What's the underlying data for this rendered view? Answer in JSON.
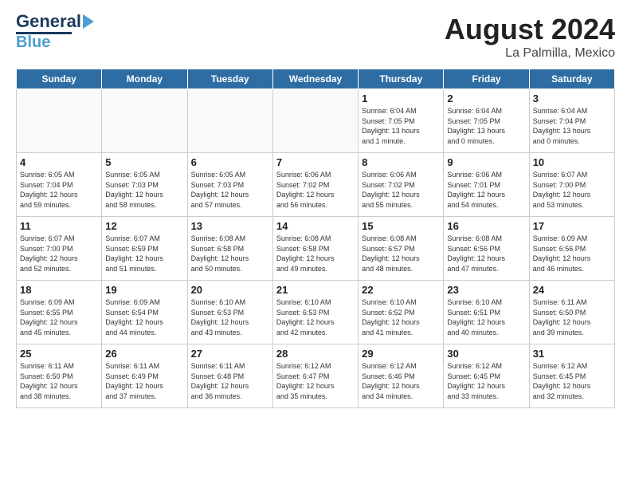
{
  "header": {
    "logo_top": "General",
    "logo_bottom": "Blue",
    "month": "August 2024",
    "location": "La Palmilla, Mexico"
  },
  "weekdays": [
    "Sunday",
    "Monday",
    "Tuesday",
    "Wednesday",
    "Thursday",
    "Friday",
    "Saturday"
  ],
  "weeks": [
    [
      {
        "day": "",
        "info": ""
      },
      {
        "day": "",
        "info": ""
      },
      {
        "day": "",
        "info": ""
      },
      {
        "day": "",
        "info": ""
      },
      {
        "day": "1",
        "info": "Sunrise: 6:04 AM\nSunset: 7:05 PM\nDaylight: 13 hours\nand 1 minute."
      },
      {
        "day": "2",
        "info": "Sunrise: 6:04 AM\nSunset: 7:05 PM\nDaylight: 13 hours\nand 0 minutes."
      },
      {
        "day": "3",
        "info": "Sunrise: 6:04 AM\nSunset: 7:04 PM\nDaylight: 13 hours\nand 0 minutes."
      }
    ],
    [
      {
        "day": "4",
        "info": "Sunrise: 6:05 AM\nSunset: 7:04 PM\nDaylight: 12 hours\nand 59 minutes."
      },
      {
        "day": "5",
        "info": "Sunrise: 6:05 AM\nSunset: 7:03 PM\nDaylight: 12 hours\nand 58 minutes."
      },
      {
        "day": "6",
        "info": "Sunrise: 6:05 AM\nSunset: 7:03 PM\nDaylight: 12 hours\nand 57 minutes."
      },
      {
        "day": "7",
        "info": "Sunrise: 6:06 AM\nSunset: 7:02 PM\nDaylight: 12 hours\nand 56 minutes."
      },
      {
        "day": "8",
        "info": "Sunrise: 6:06 AM\nSunset: 7:02 PM\nDaylight: 12 hours\nand 55 minutes."
      },
      {
        "day": "9",
        "info": "Sunrise: 6:06 AM\nSunset: 7:01 PM\nDaylight: 12 hours\nand 54 minutes."
      },
      {
        "day": "10",
        "info": "Sunrise: 6:07 AM\nSunset: 7:00 PM\nDaylight: 12 hours\nand 53 minutes."
      }
    ],
    [
      {
        "day": "11",
        "info": "Sunrise: 6:07 AM\nSunset: 7:00 PM\nDaylight: 12 hours\nand 52 minutes."
      },
      {
        "day": "12",
        "info": "Sunrise: 6:07 AM\nSunset: 6:59 PM\nDaylight: 12 hours\nand 51 minutes."
      },
      {
        "day": "13",
        "info": "Sunrise: 6:08 AM\nSunset: 6:58 PM\nDaylight: 12 hours\nand 50 minutes."
      },
      {
        "day": "14",
        "info": "Sunrise: 6:08 AM\nSunset: 6:58 PM\nDaylight: 12 hours\nand 49 minutes."
      },
      {
        "day": "15",
        "info": "Sunrise: 6:08 AM\nSunset: 6:57 PM\nDaylight: 12 hours\nand 48 minutes."
      },
      {
        "day": "16",
        "info": "Sunrise: 6:08 AM\nSunset: 6:56 PM\nDaylight: 12 hours\nand 47 minutes."
      },
      {
        "day": "17",
        "info": "Sunrise: 6:09 AM\nSunset: 6:56 PM\nDaylight: 12 hours\nand 46 minutes."
      }
    ],
    [
      {
        "day": "18",
        "info": "Sunrise: 6:09 AM\nSunset: 6:55 PM\nDaylight: 12 hours\nand 45 minutes."
      },
      {
        "day": "19",
        "info": "Sunrise: 6:09 AM\nSunset: 6:54 PM\nDaylight: 12 hours\nand 44 minutes."
      },
      {
        "day": "20",
        "info": "Sunrise: 6:10 AM\nSunset: 6:53 PM\nDaylight: 12 hours\nand 43 minutes."
      },
      {
        "day": "21",
        "info": "Sunrise: 6:10 AM\nSunset: 6:53 PM\nDaylight: 12 hours\nand 42 minutes."
      },
      {
        "day": "22",
        "info": "Sunrise: 6:10 AM\nSunset: 6:52 PM\nDaylight: 12 hours\nand 41 minutes."
      },
      {
        "day": "23",
        "info": "Sunrise: 6:10 AM\nSunset: 6:51 PM\nDaylight: 12 hours\nand 40 minutes."
      },
      {
        "day": "24",
        "info": "Sunrise: 6:11 AM\nSunset: 6:50 PM\nDaylight: 12 hours\nand 39 minutes."
      }
    ],
    [
      {
        "day": "25",
        "info": "Sunrise: 6:11 AM\nSunset: 6:50 PM\nDaylight: 12 hours\nand 38 minutes."
      },
      {
        "day": "26",
        "info": "Sunrise: 6:11 AM\nSunset: 6:49 PM\nDaylight: 12 hours\nand 37 minutes."
      },
      {
        "day": "27",
        "info": "Sunrise: 6:11 AM\nSunset: 6:48 PM\nDaylight: 12 hours\nand 36 minutes."
      },
      {
        "day": "28",
        "info": "Sunrise: 6:12 AM\nSunset: 6:47 PM\nDaylight: 12 hours\nand 35 minutes."
      },
      {
        "day": "29",
        "info": "Sunrise: 6:12 AM\nSunset: 6:46 PM\nDaylight: 12 hours\nand 34 minutes."
      },
      {
        "day": "30",
        "info": "Sunrise: 6:12 AM\nSunset: 6:45 PM\nDaylight: 12 hours\nand 33 minutes."
      },
      {
        "day": "31",
        "info": "Sunrise: 6:12 AM\nSunset: 6:45 PM\nDaylight: 12 hours\nand 32 minutes."
      }
    ]
  ]
}
